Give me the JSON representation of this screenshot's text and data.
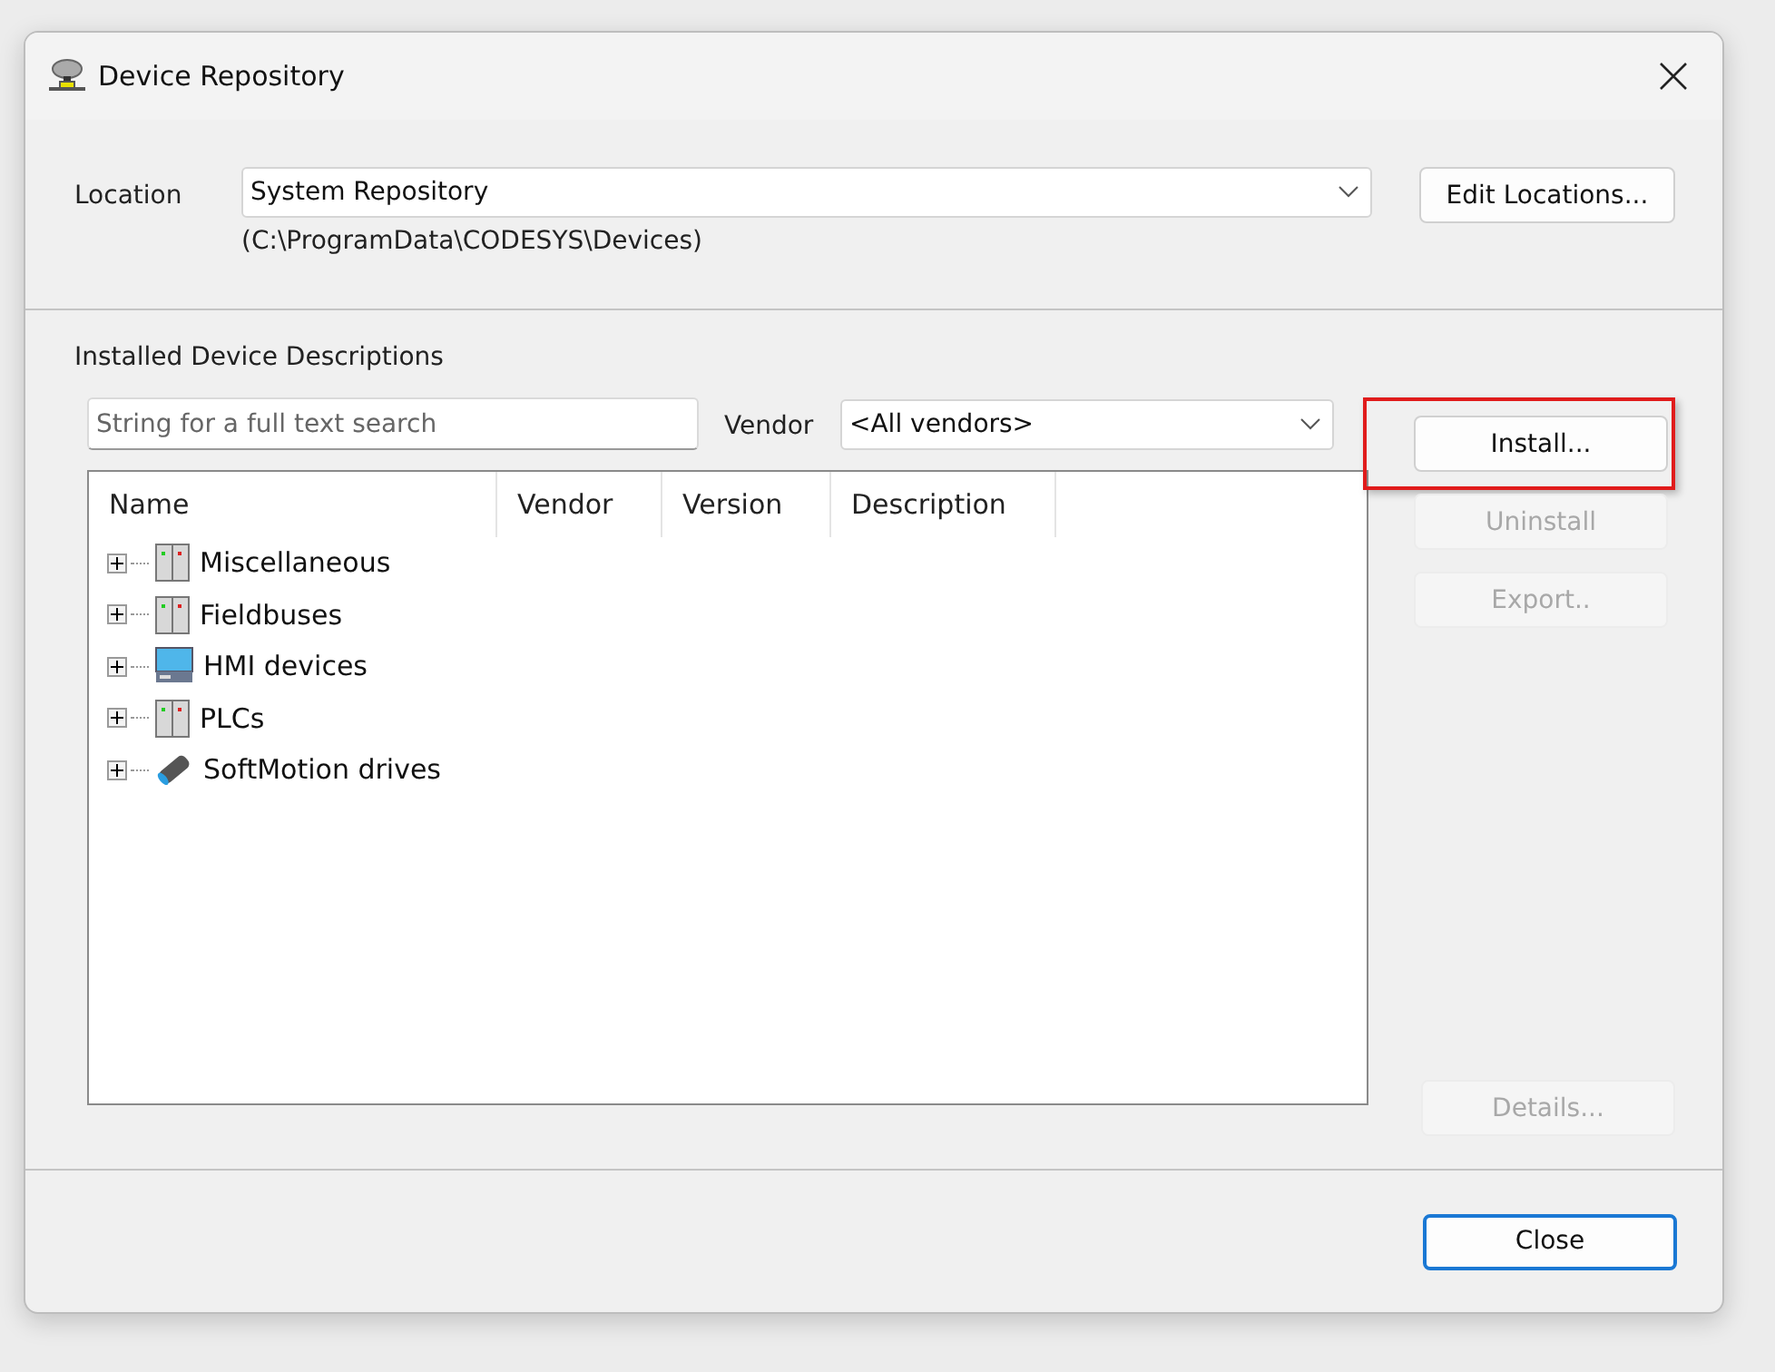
{
  "window": {
    "title": "Device Repository"
  },
  "location": {
    "label": "Location",
    "value": "System Repository",
    "path": "(C:\\ProgramData\\CODESYS\\Devices)",
    "button": "Edit Locations..."
  },
  "installed": {
    "heading": "Installed Device Descriptions",
    "search": {
      "placeholder": "String for a full text search"
    },
    "vendor_label": "Vendor",
    "vendor_value": "<All vendors>"
  },
  "table": {
    "columns": [
      "Name",
      "Vendor",
      "Version",
      "Description"
    ],
    "rows": [
      {
        "name": "Miscellaneous",
        "kind": "rack",
        "expanded": false
      },
      {
        "name": "Fieldbuses",
        "kind": "rack",
        "expanded": false
      },
      {
        "name": "HMI devices",
        "kind": "hmi",
        "expanded": false
      },
      {
        "name": "PLCs",
        "kind": "rack",
        "expanded": false
      },
      {
        "name": "SoftMotion drives",
        "kind": "drive",
        "expanded": false
      }
    ]
  },
  "side_buttons": [
    {
      "label": "Install...",
      "disabled": false,
      "highlighted": true
    },
    {
      "label": "Uninstall",
      "disabled": true,
      "highlighted": false
    },
    {
      "label": "Export..",
      "disabled": true,
      "highlighted": false
    }
  ],
  "details_button": {
    "label": "Details...",
    "disabled": true
  },
  "close_button": {
    "label": "Close"
  }
}
